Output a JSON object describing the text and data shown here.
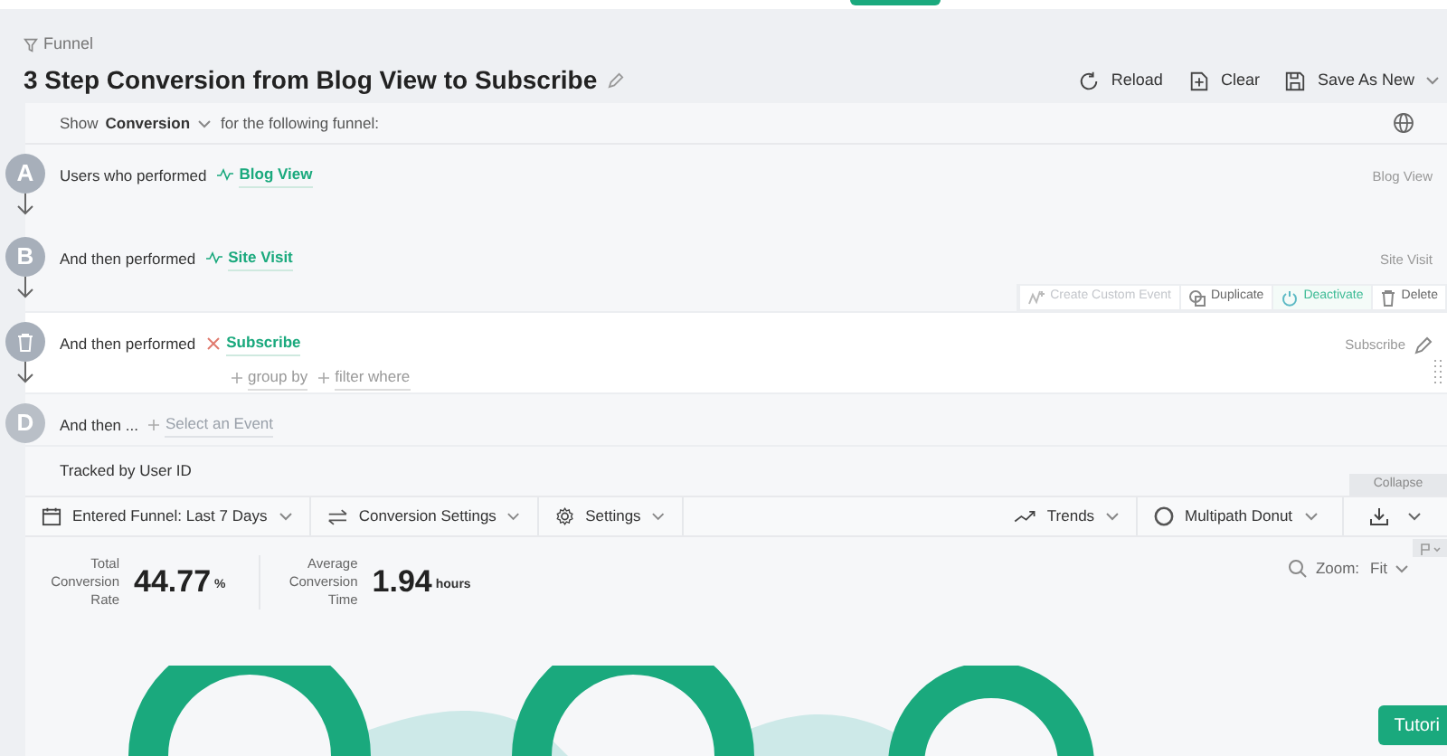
{
  "breadcrumb": "Funnel",
  "title": "3 Step Conversion from Blog View to Subscribe",
  "header_actions": [
    {
      "kind": "reload",
      "label": "Reload"
    },
    {
      "kind": "clear",
      "label": "Clear"
    },
    {
      "kind": "save",
      "label": "Save As New"
    }
  ],
  "show_row": {
    "prefix": "Show",
    "metric": "Conversion",
    "suffix": "for the following funnel:"
  },
  "steps": [
    {
      "marker": "A",
      "kind": "event",
      "hovered": false,
      "prefix": "Users who performed",
      "event": "Blog View",
      "right_label": "Blog View"
    },
    {
      "marker": "B",
      "kind": "event",
      "hovered": false,
      "prefix": "And then performed",
      "event": "Site Visit",
      "right_label": "Site Visit"
    },
    {
      "kind": "event",
      "hovered": true,
      "prefix": "And then performed",
      "event": "Subscribe",
      "right_label": "Subscribe",
      "options": [
        "group by",
        "filter where"
      ]
    },
    {
      "marker": "D",
      "kind": "empty",
      "hovered": false,
      "prefix": "And then ...",
      "placeholder": "Select an Event"
    }
  ],
  "step_actions": [
    {
      "kind": "custom",
      "label": "Create Custom Event",
      "disabled": true,
      "highlighted": false
    },
    {
      "kind": "duplicate",
      "label": "Duplicate",
      "disabled": false,
      "highlighted": false
    },
    {
      "kind": "deactivate",
      "label": "Deactivate",
      "disabled": false,
      "highlighted": true
    },
    {
      "kind": "delete",
      "label": "Delete",
      "disabled": false,
      "highlighted": false
    }
  ],
  "tracked_by": "Tracked by User ID",
  "collapse": "Collapse",
  "toolbar_left": [
    {
      "kind": "calendar",
      "label": "Entered Funnel: Last 7 Days"
    },
    {
      "kind": "swap",
      "label": "Conversion Settings"
    },
    {
      "kind": "gear",
      "label": "Settings"
    }
  ],
  "toolbar_right": [
    {
      "kind": "trend",
      "label": "Trends"
    },
    {
      "kind": "donut",
      "label": "Multipath Donut"
    }
  ],
  "stats": [
    {
      "label": "Total Conversion Rate",
      "value": "44.77",
      "unit": "%"
    },
    {
      "label": "Average Conversion Time",
      "value": "1.94",
      "unit": "hours"
    }
  ],
  "zoom": {
    "label": "Zoom:",
    "value": "Fit"
  },
  "tutorial": "Tutori"
}
